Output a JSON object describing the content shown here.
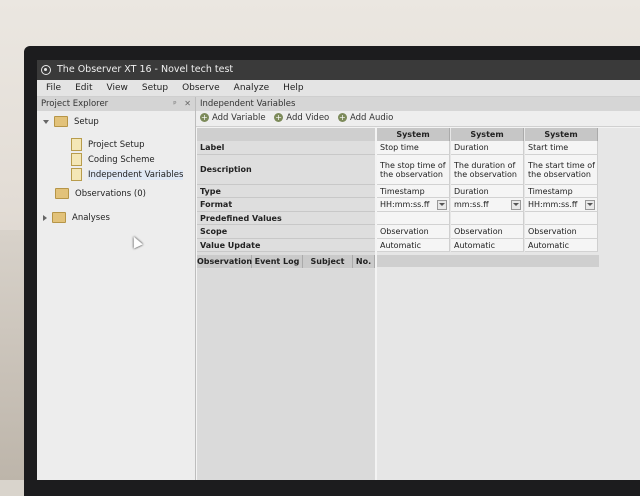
{
  "window": {
    "title": "The Observer XT 16 - Novel tech test"
  },
  "menu": [
    "File",
    "Edit",
    "View",
    "Setup",
    "Observe",
    "Analyze",
    "Help"
  ],
  "project_explorer": {
    "title": "Project Explorer",
    "pin_glyph": "ᵖ",
    "close_glyph": "✕",
    "tree": {
      "setup": "Setup",
      "project_setup": "Project Setup",
      "coding_scheme": "Coding Scheme",
      "independent_variables": "Independent Variables",
      "observations": "Observations (0)",
      "analyses": "Analyses"
    }
  },
  "panel": {
    "title": "Independent Variables"
  },
  "toolbar": {
    "add_variable": "Add Variable",
    "add_video": "Add Video",
    "add_audio": "Add Audio"
  },
  "properties": {
    "label": "Label",
    "description": "Description",
    "type": "Type",
    "format": "Format",
    "predefined_values": "Predefined Values",
    "scope": "Scope",
    "value_update": "Value Update"
  },
  "observation_columns": [
    "Observation",
    "Event Log",
    "Subject",
    "No."
  ],
  "variables": [
    {
      "header": "System",
      "label": "Stop time",
      "description": "The stop time of the observation",
      "type": "Timestamp",
      "format": "HH:mm:ss.ff",
      "scope": "Observation",
      "value_update": "Automatic"
    },
    {
      "header": "System",
      "label": "Duration",
      "description": "The duration of the observation",
      "type": "Duration",
      "format": "mm:ss.ff",
      "scope": "Observation",
      "value_update": "Automatic"
    },
    {
      "header": "System",
      "label": "Start time",
      "description": "The start time of the observation",
      "type": "Timestamp",
      "format": "HH:mm:ss.ff",
      "scope": "Observation",
      "value_update": "Automatic"
    }
  ]
}
